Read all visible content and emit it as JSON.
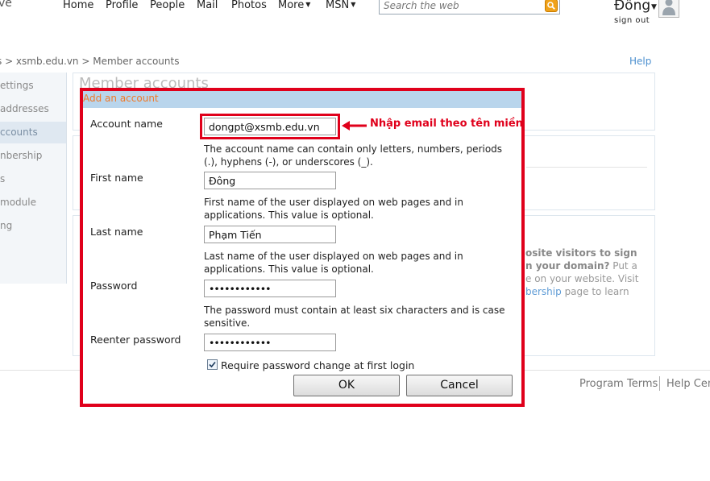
{
  "header": {
    "brand_fragment": "ve",
    "brand_mark": "™",
    "nav": [
      {
        "label": "Home"
      },
      {
        "label": "Profile"
      },
      {
        "label": "People"
      },
      {
        "label": "Mail"
      },
      {
        "label": "Photos"
      },
      {
        "label": "More",
        "dropdown": true
      },
      {
        "label": "MSN",
        "dropdown": true
      }
    ],
    "search_placeholder": "Search the web",
    "user_name": "Đông",
    "sign_out": "sign out"
  },
  "breadcrumb": "s > xsmb.edu.vn > Member accounts",
  "help_link": "Help",
  "sidebar": {
    "items": [
      {
        "label": "ettings"
      },
      {
        "label": " addresses"
      },
      {
        "label": "ccounts",
        "active": true
      },
      {
        "label": "nbership"
      },
      {
        "label": "s"
      },
      {
        "label": " module"
      },
      {
        "label": "ng"
      }
    ]
  },
  "background": {
    "panel_title_fragment": "Member accounts",
    "promo_line1": "osite visitors to sign",
    "promo_line2_bold": "n your domain?",
    "promo_line2_rest": " Put a",
    "promo_line3": "e on your website. Visit",
    "promo_line4_link": "bership",
    "promo_line4_rest": " page to learn"
  },
  "footer": {
    "program_terms": "Program Terms",
    "help_center": "Help Cent"
  },
  "dialog": {
    "title": "Add an account",
    "account_name_label": "Account name",
    "account_name_value": "dongpt@xsmb.edu.vn",
    "account_name_help": "The account name can contain only letters, numbers, periods (.), hyphens (-), or underscores (_).",
    "first_name_label": "First name",
    "first_name_value": "Đông",
    "first_name_help": "First name of the user displayed on web pages and in applications. This value is optional.",
    "last_name_label": "Last name",
    "last_name_value": "Phạm Tiến",
    "last_name_help": "Last name of the user displayed on web pages and in applications. This value is optional.",
    "password_label": "Password",
    "password_value": "••••••••••••",
    "password_help": "The password must contain at least six characters and is case sensitive.",
    "reenter_label": "Reenter password",
    "reenter_value": "••••••••••••",
    "require_change_label": "Require password change at first login",
    "require_change_checked": true,
    "ok_label": "OK",
    "cancel_label": "Cancel"
  },
  "annotation": {
    "text": "Nhập email theo tên miền",
    "color": "#e0001b"
  }
}
